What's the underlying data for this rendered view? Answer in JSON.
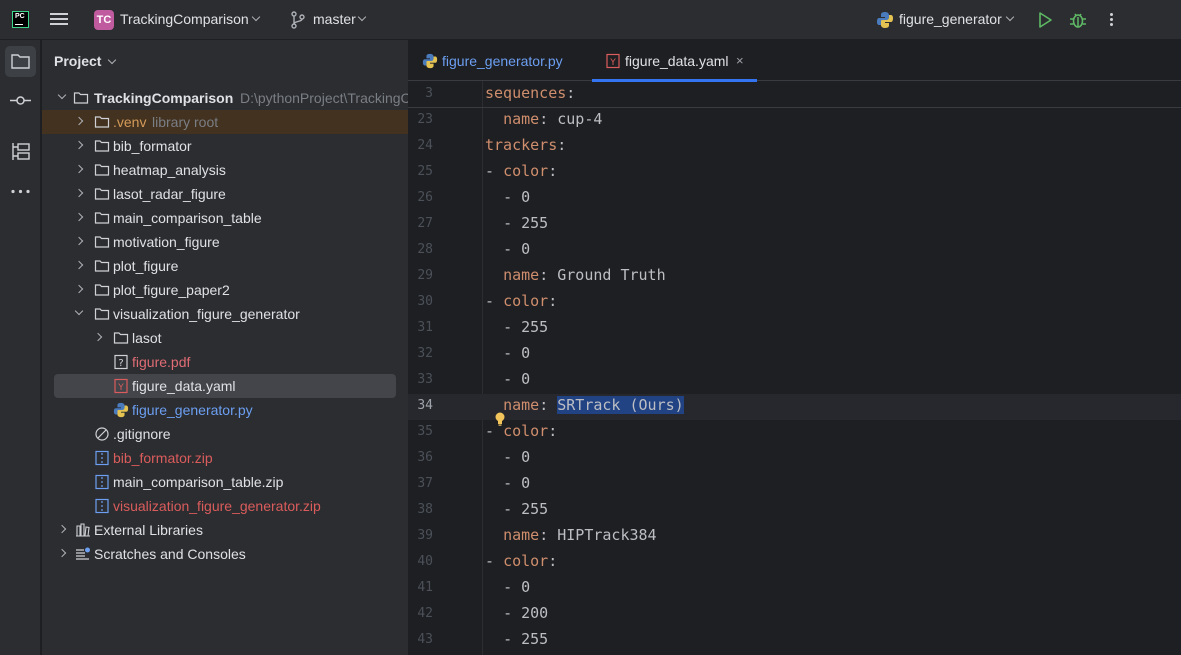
{
  "titlebar": {
    "app_logo": "PC",
    "project_badge": "TC",
    "project_name": "TrackingComparison",
    "branch": "master",
    "run_config": "figure_generator",
    "colors": {
      "project_badge": "#c15b9f",
      "run": "#5fb865",
      "debug": "#5fb865"
    }
  },
  "toolstrip": {
    "items": [
      "folder-icon",
      "commit-icon",
      "structure-icon",
      "more-icon"
    ]
  },
  "project_panel": {
    "title": "Project",
    "root": {
      "name": "TrackingComparison",
      "path": "D:\\pythonProject\\TrackingC"
    },
    "items": [
      {
        "label": ".venv",
        "hint": "library root"
      },
      {
        "label": "bib_formator"
      },
      {
        "label": "heatmap_analysis"
      },
      {
        "label": "lasot_radar_figure"
      },
      {
        "label": "main_comparison_table"
      },
      {
        "label": "motivation_figure"
      },
      {
        "label": "plot_figure"
      },
      {
        "label": "plot_figure_paper2"
      },
      {
        "label": "visualization_figure_generator"
      },
      {
        "label": "lasot"
      },
      {
        "label": "figure.pdf"
      },
      {
        "label": "figure_data.yaml"
      },
      {
        "label": "figure_generator.py"
      },
      {
        "label": ".gitignore"
      },
      {
        "label": "bib_formator.zip"
      },
      {
        "label": "main_comparison_table.zip"
      },
      {
        "label": "visualization_figure_generator.zip"
      },
      {
        "label": "External Libraries"
      },
      {
        "label": "Scratches and Consoles"
      }
    ]
  },
  "editor": {
    "tabs": [
      {
        "label": "figure_generator.py",
        "active": false
      },
      {
        "label": "figure_data.yaml",
        "active": true
      }
    ],
    "close_glyph": "×",
    "lines": [
      {
        "n": "3",
        "indent": "",
        "dash": "",
        "key": "sequences",
        "value": ""
      },
      {
        "n": "23",
        "indent": "  ",
        "dash": "",
        "key": "name",
        "value": "cup-4"
      },
      {
        "n": "24",
        "indent": "",
        "dash": "",
        "key": "trackers",
        "value": ""
      },
      {
        "n": "25",
        "indent": "",
        "dash": "- ",
        "key": "color",
        "value": ""
      },
      {
        "n": "26",
        "indent": "  ",
        "dash": "- ",
        "key": "",
        "value": "0"
      },
      {
        "n": "27",
        "indent": "  ",
        "dash": "- ",
        "key": "",
        "value": "255"
      },
      {
        "n": "28",
        "indent": "  ",
        "dash": "- ",
        "key": "",
        "value": "0"
      },
      {
        "n": "29",
        "indent": "  ",
        "dash": "",
        "key": "name",
        "value": "Ground Truth"
      },
      {
        "n": "30",
        "indent": "",
        "dash": "- ",
        "key": "color",
        "value": ""
      },
      {
        "n": "31",
        "indent": "  ",
        "dash": "- ",
        "key": "",
        "value": "255"
      },
      {
        "n": "32",
        "indent": "  ",
        "dash": "- ",
        "key": "",
        "value": "0"
      },
      {
        "n": "33",
        "indent": "  ",
        "dash": "- ",
        "key": "",
        "value": "0"
      },
      {
        "n": "34",
        "indent": "  ",
        "dash": "",
        "key": "name",
        "value": "SRTrack (Ours)"
      },
      {
        "n": "35",
        "indent": "",
        "dash": "- ",
        "key": "color",
        "value": ""
      },
      {
        "n": "36",
        "indent": "  ",
        "dash": "- ",
        "key": "",
        "value": "0"
      },
      {
        "n": "37",
        "indent": "  ",
        "dash": "- ",
        "key": "",
        "value": "0"
      },
      {
        "n": "38",
        "indent": "  ",
        "dash": "- ",
        "key": "",
        "value": "255"
      },
      {
        "n": "39",
        "indent": "  ",
        "dash": "",
        "key": "name",
        "value": "HIPTrack384"
      },
      {
        "n": "40",
        "indent": "",
        "dash": "- ",
        "key": "color",
        "value": ""
      },
      {
        "n": "41",
        "indent": "  ",
        "dash": "- ",
        "key": "",
        "value": "0"
      },
      {
        "n": "42",
        "indent": "  ",
        "dash": "- ",
        "key": "",
        "value": "200"
      },
      {
        "n": "43",
        "indent": "  ",
        "dash": "- ",
        "key": "",
        "value": "255"
      }
    ],
    "current_line": "34",
    "colors": {
      "key": "#cf8e6d",
      "text": "#bcbec4",
      "selection": "#214283",
      "tab_underline": "#3574f0"
    }
  }
}
